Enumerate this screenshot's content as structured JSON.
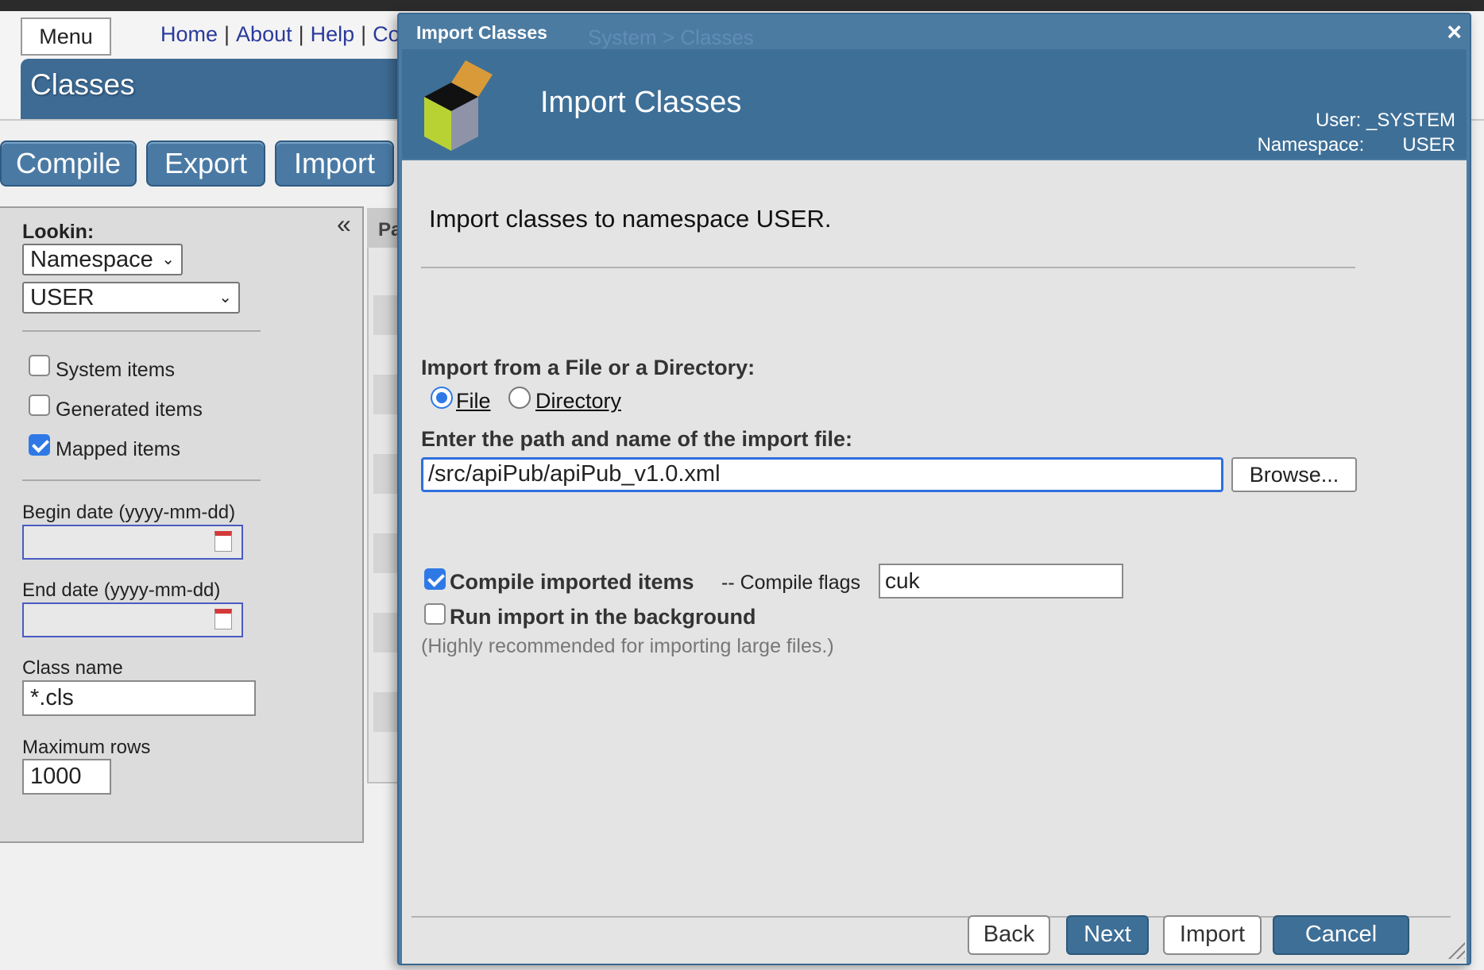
{
  "background": {
    "menu_label": "Menu",
    "links": [
      "Home",
      "About",
      "Help",
      "Cont"
    ],
    "page_title": "Classes",
    "commands": [
      "Compile",
      "Export",
      "Import"
    ],
    "collapse_glyph": "«",
    "content_header_fragment": "Pa"
  },
  "sidebar": {
    "lookin_label": "Lookin:",
    "lookin_value": "Namespace",
    "namespace_value": "USER",
    "checkboxes": [
      {
        "label": "System items",
        "checked": false
      },
      {
        "label": "Generated items",
        "checked": false
      },
      {
        "label": "Mapped items",
        "checked": true
      }
    ],
    "begin_date_label": "Begin date (yyyy-mm-dd)",
    "begin_date_value": "",
    "end_date_label": "End date (yyyy-mm-dd)",
    "end_date_value": "",
    "class_name_label": "Class name",
    "class_name_value": "*.cls",
    "max_rows_label": "Maximum rows",
    "max_rows_value": "1000"
  },
  "modal": {
    "window_title": "Import Classes",
    "ghost_breadcrumb": "System > Classes",
    "close_glyph": "×",
    "header_title": "Import Classes",
    "user_label": "User:",
    "user_value": "_SYSTEM",
    "namespace_label": "Namespace:",
    "namespace_value": "USER",
    "intro": "Import classes to namespace USER.",
    "source_label": "Import from a File or a Directory:",
    "source_options": [
      {
        "label": "File",
        "selected": true
      },
      {
        "label": "Directory",
        "selected": false
      }
    ],
    "path_label": "Enter the path and name of the import file:",
    "path_value": "/src/apiPub/apiPub_v1.0.xml",
    "browse_label": "Browse...",
    "compile_label": "Compile imported items",
    "compile_checked": true,
    "flags_label": "-- Compile flags",
    "flags_value": "cuk",
    "background_label": "Run import in the background",
    "background_checked": false,
    "hint": "(Highly recommended for importing large files.)",
    "buttons": {
      "back": "Back",
      "next": "Next",
      "import": "Import",
      "cancel": "Cancel"
    }
  },
  "colors": {
    "header_blue": "#3e6f97",
    "accent_blue": "#2f79e6",
    "link_blue": "#2a3a9c"
  }
}
